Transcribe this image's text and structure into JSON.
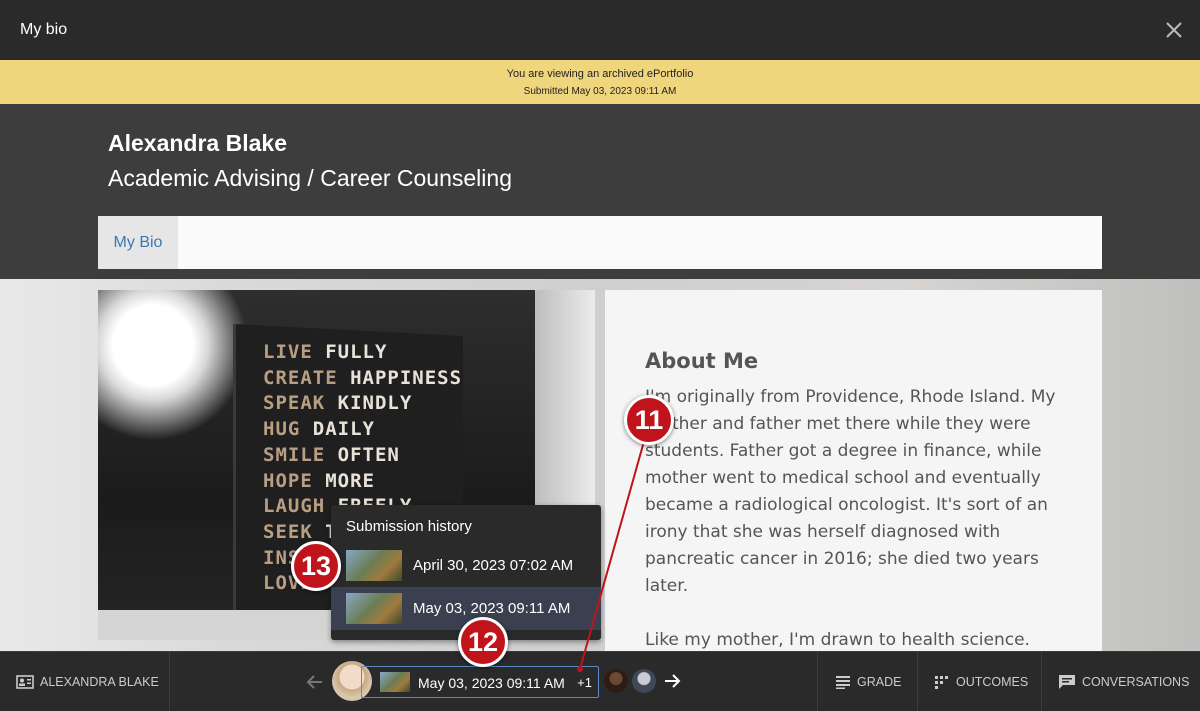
{
  "window": {
    "title": "My bio"
  },
  "banner": {
    "line1": "You are viewing an archived ePortfolio",
    "line2": "Submitted May 03, 2023 09:11 AM"
  },
  "header": {
    "name": "Alexandra Blake",
    "subtitle": "Academic Advising / Career Counseling"
  },
  "nav": {
    "tabs": [
      {
        "label": "My Bio"
      }
    ]
  },
  "book": {
    "rows": [
      {
        "a": "LIVE",
        "b": " FULLY"
      },
      {
        "a": "CREATE",
        "b": " HAPPINESS"
      },
      {
        "a": "SPEAK",
        "b": " KINDLY"
      },
      {
        "a": "HUG",
        "b": " DAILY"
      },
      {
        "a": "SMILE",
        "b": " OFTEN"
      },
      {
        "a": "HOPE",
        "b": " MORE"
      },
      {
        "a": "LAUGH",
        "b": " FREELY"
      },
      {
        "a": "SEEK",
        "b": " T"
      },
      {
        "a": "INS",
        "b": ""
      },
      {
        "a": "LOVE",
        "b": ""
      }
    ]
  },
  "about": {
    "heading": "About Me",
    "paragraphs": [
      "I'm originally from Providence, Rhode Island. My mother and father met there while they were students. Father got a degree in finance, while mother went to medical school and eventually became a radiological oncologist. It's sort of an irony that she was herself diagnosed with pancreatic cancer in 2016; she died two years later.",
      "Like my mother, I'm drawn to health science."
    ]
  },
  "submission_history": {
    "title": "Submission history",
    "items": [
      {
        "date": "April 30, 2023 07:02 AM",
        "selected": false
      },
      {
        "date": "May 03, 2023 09:11 AM",
        "selected": true
      }
    ]
  },
  "footer": {
    "student_label": "ALEXANDRA BLAKE",
    "current_submission": "May 03, 2023 09:11 AM",
    "more_count": "+1",
    "grade_label": "GRADE",
    "outcomes_label": "OUTCOMES",
    "conversations_label": "CONVERSATIONS"
  },
  "callouts": {
    "c11": "11",
    "c12": "12",
    "c13": "13"
  },
  "colors": {
    "banner": "#efd57c",
    "callout": "#c0131b",
    "selection_border": "#5b89c4",
    "link": "#3a78b5"
  }
}
